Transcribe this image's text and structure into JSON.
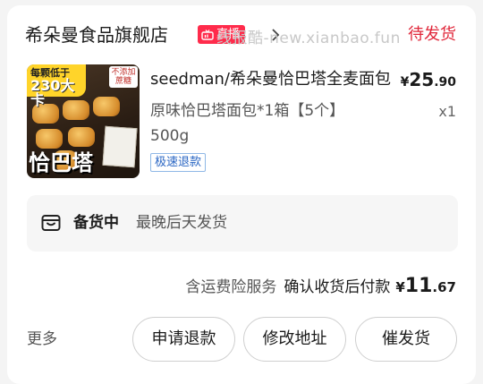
{
  "watermark": "线报酷-new.xianbao.fun",
  "shop": {
    "name": "希朵曼食品旗舰店",
    "live_badge": "直播",
    "status": "待发货",
    "icons": {
      "live": "tv-icon",
      "chevron": "chevron-right-icon"
    }
  },
  "product": {
    "thumbnail": {
      "tag_text": "每颗低于",
      "tag_number": "230大卡",
      "side_note": "不添加蔗糖",
      "caption": "恰巴塔"
    },
    "title": "seedman/希朵曼恰巴塔全麦面包",
    "price": {
      "symbol": "¥",
      "int": "25",
      "dec": ".90"
    },
    "sku": "原味恰巴塔面包*1箱【5个】500g",
    "qty": "x1",
    "refund_tag": "极速退款"
  },
  "shipping": {
    "icon": "box-icon",
    "status": "备货中",
    "note": "最晚后天发货"
  },
  "summary": {
    "insurance": "含运费险服务",
    "pay_label": "确认收货后付款",
    "total": {
      "symbol": "¥",
      "int": "11",
      "dec": ".67"
    }
  },
  "actions": {
    "more": "更多",
    "refund": "申请退款",
    "edit_address": "修改地址",
    "urge_shipping": "催发货"
  }
}
